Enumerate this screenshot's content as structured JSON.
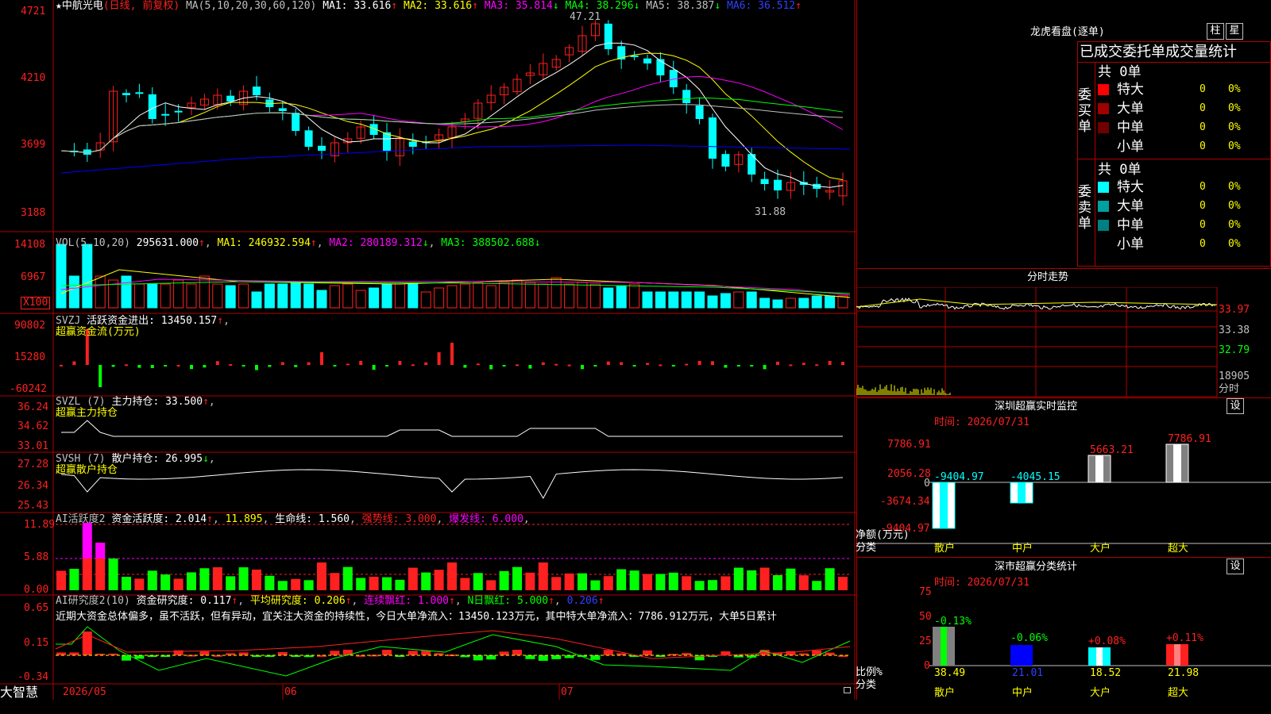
{
  "colors": {
    "up": "#ff2020",
    "down": "#00ffff",
    "frame": "#b00000",
    "white": "#ffffff",
    "yellow": "#ffff00",
    "magenta": "#ff00ff",
    "green": "#00ff00",
    "blue": "#0000ff"
  },
  "header": {
    "star": "★",
    "title": "中航光电",
    "mode": "(日线, 前复权)",
    "ma_label": "MA(5,10,20,30,60,120)",
    "ma": [
      {
        "k": "MA1:",
        "v": "33.616",
        "a": "↑"
      },
      {
        "k": "MA2:",
        "v": "33.616",
        "a": "↑"
      },
      {
        "k": "MA3:",
        "v": "35.814",
        "a": "↓"
      },
      {
        "k": "MA4:",
        "v": "38.296",
        "a": "↓"
      },
      {
        "k": "MA5:",
        "v": "38.387",
        "a": "↓"
      },
      {
        "k": "MA6:",
        "v": "36.512",
        "a": "↑"
      }
    ],
    "high_label": "47.21",
    "low_label": "31.88"
  },
  "price_axis": [
    "4721",
    "4210",
    "3699",
    "3188"
  ],
  "vol": {
    "label": "VOL(5,10,20)",
    "v": "295631.000",
    "a": "↑",
    "ma1": "MA1: 246932.594",
    "ma1a": "↑",
    "ma2": "MA2: 280189.312",
    "ma2a": "↓",
    "ma3": "MA3: 388502.688",
    "ma3a": "↓",
    "axis": [
      "14108",
      "6967"
    ],
    "unit": "X100"
  },
  "svzj": {
    "title": "SVZJ",
    "t1": "活跃资金进出:",
    "v1": "13450.157",
    "a": "↑",
    "sub": "超赢资金流(万元)",
    "axis": [
      "90802",
      "15280",
      "-60242"
    ]
  },
  "svzl": {
    "title": "SVZL (7)",
    "t1": "主力持仓:",
    "v1": "33.500",
    "a": "↑",
    "sub": "超赢主力持仓",
    "axis": [
      "36.24",
      "34.62",
      "33.01"
    ]
  },
  "svsh": {
    "title": "SVSH (7)",
    "t1": "散户持仓:",
    "v1": "26.995",
    "a": "↓",
    "sub": "超赢散户持仓",
    "axis": [
      "27.28",
      "26.34",
      "25.43"
    ]
  },
  "ai1": {
    "title": "AI活跃度2",
    "t1": "资金活跃度:",
    "v1": "2.014",
    "a": "↑",
    "v2": "11.895",
    "t3": "生命线:",
    "v3": "1.560",
    "t4": "强势线:",
    "v4": "3.000",
    "t5": "爆发线:",
    "v5": "6.000",
    "axis": [
      "11.89",
      "5.88",
      "0.00"
    ]
  },
  "ai2": {
    "title": "AI研究度2(10)",
    "t1": "资金研究度:",
    "v1": "0.117",
    "a1": "↑",
    "t2": "平均研究度:",
    "v2": "0.206",
    "a2": "↑",
    "t3": "连续飘红:",
    "v3": "1.000",
    "a3": "↑",
    "t4": "N日飘红:",
    "v4": "5.000",
    "a4": "↑",
    "v5": "0.206",
    "a5": "↑",
    "msg": "近期大资金总体偏多，虽不活跃，但有异动，宜关注大资金的持续性，今日大单净流入：13450.123万元，其中特大单净流入：7786.912万元，大单5日累计",
    "axis": [
      "0.65",
      "0.15",
      "-0.34"
    ]
  },
  "date_axis": [
    "2026/05",
    "06",
    "07"
  ],
  "brand": "大智慧",
  "lhb": {
    "title": "龙虎看盘(逐单)",
    "btn1": "柱",
    "btn2": "星",
    "subtitle": "已成交委托单成交量统计",
    "buy": {
      "side": "委买单",
      "total": "共 0单",
      "rows": [
        {
          "name": "特大",
          "v": "0",
          "p": "0%",
          "c": "#ff0000"
        },
        {
          "name": "大单",
          "v": "0",
          "p": "0%",
          "c": "#a00000"
        },
        {
          "name": "中单",
          "v": "0",
          "p": "0%",
          "c": "#700000"
        },
        {
          "name": "小单",
          "v": "0",
          "p": "0%",
          "c": ""
        }
      ]
    },
    "sell": {
      "side": "委卖单",
      "total": "共 0单",
      "rows": [
        {
          "name": "特大",
          "v": "0",
          "p": "0%",
          "c": "#00ffff"
        },
        {
          "name": "大单",
          "v": "0",
          "p": "0%",
          "c": "#00a0a0"
        },
        {
          "name": "中单",
          "v": "0",
          "p": "0%",
          "c": "#008080"
        },
        {
          "name": "小单",
          "v": "0",
          "p": "0%",
          "c": ""
        }
      ]
    }
  },
  "intraday": {
    "title": "分时走势",
    "right_labels": [
      "33.97",
      "33.38",
      "32.79",
      "18905",
      "分时"
    ]
  },
  "monitor": {
    "title": "深圳超赢实时监控",
    "btn": "设",
    "time": "时间: 2026/07/31",
    "axis": [
      "7786.91",
      "2056.28",
      "0",
      "-3674.34",
      "-9404.97"
    ],
    "cats": [
      "散户",
      "中户",
      "大户",
      "超大"
    ],
    "values": [
      "-9404.97",
      "-4045.15",
      "5663.21",
      "7786.91"
    ],
    "ylabel1": "净额(万元)",
    "ylabel2": "分类"
  },
  "stats": {
    "title": "深市超赢分类统计",
    "btn": "设",
    "time": "时间: 2026/07/31",
    "axis": [
      "75",
      "50",
      "25",
      "0"
    ],
    "cats": [
      "散户",
      "中户",
      "大户",
      "超大"
    ],
    "values": [
      "38.49",
      "21.01",
      "18.52",
      "21.98"
    ],
    "changes": [
      "-0.13%",
      "-0.06%",
      "+0.08%",
      "+0.11%"
    ],
    "ylabel1": "比例%",
    "ylabel2": "分类"
  }
}
